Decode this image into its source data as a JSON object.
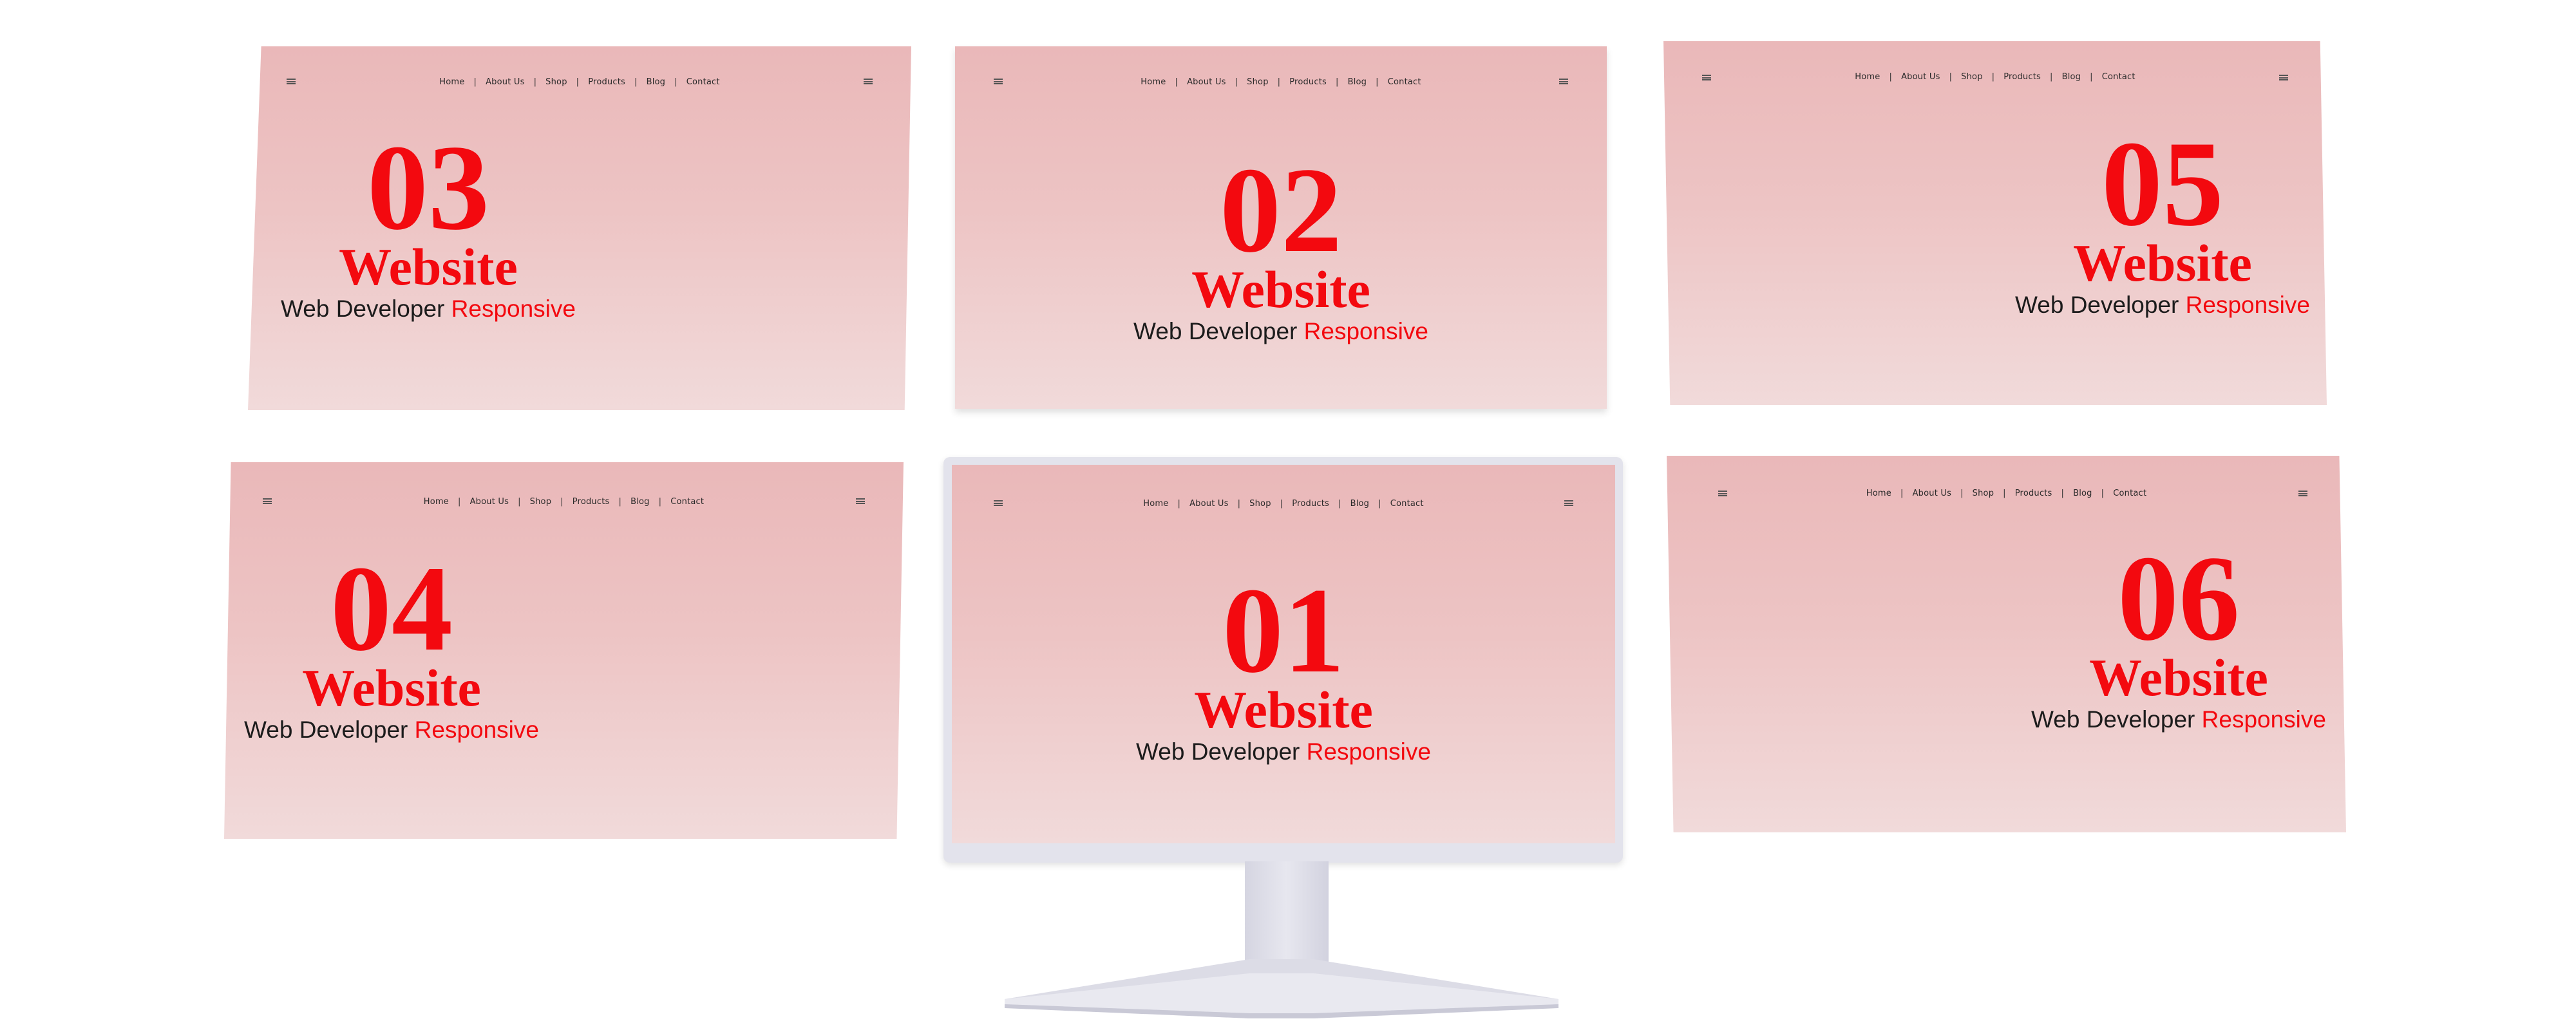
{
  "nav": {
    "items": [
      "Home",
      "About Us",
      "Shop",
      "Products",
      "Blog",
      "Contact"
    ],
    "separator": "|"
  },
  "icons": {
    "menu": "hamburger-menu-icon"
  },
  "panels": [
    {
      "number": "03",
      "title": "Website",
      "subtitle": "Web Developer",
      "highlight": "Responsive"
    },
    {
      "number": "02",
      "title": "Website",
      "subtitle": "Web Developer",
      "highlight": "Responsive"
    },
    {
      "number": "05",
      "title": "Website",
      "subtitle": "Web Developer",
      "highlight": "Responsive"
    },
    {
      "number": "04",
      "title": "Website",
      "subtitle": "Web Developer",
      "highlight": "Responsive"
    },
    {
      "number": "01",
      "title": "Website",
      "subtitle": "Web Developer",
      "highlight": "Responsive"
    },
    {
      "number": "06",
      "title": "Website",
      "subtitle": "Web Developer",
      "highlight": "Responsive"
    }
  ],
  "colors": {
    "accent": "#f3090f",
    "panel_top": "#eab8b9",
    "panel_bottom": "#f1dada",
    "monitor": "#e3e3ec"
  }
}
